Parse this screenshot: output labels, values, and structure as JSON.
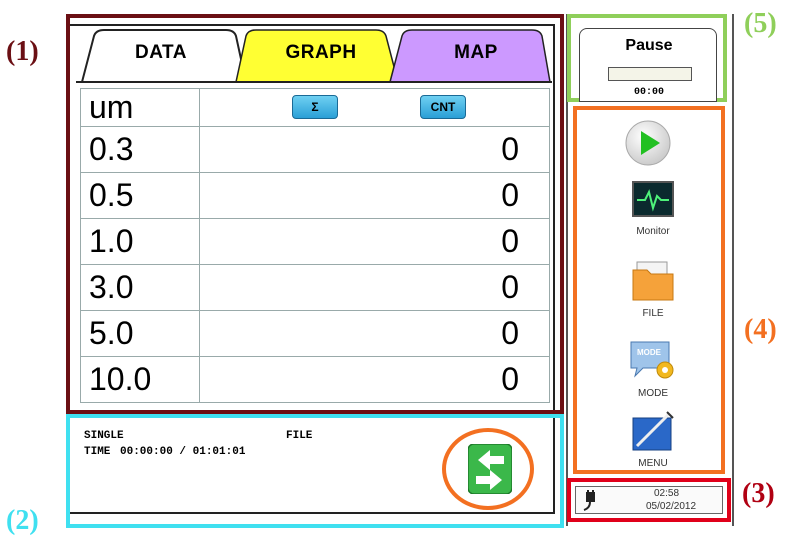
{
  "callouts": {
    "c1": "(1)",
    "c2": "(2)",
    "c3": "(3)",
    "c4": "(4)",
    "c5": "(5)"
  },
  "tabs": [
    {
      "label": "DATA",
      "color": "#ffffff"
    },
    {
      "label": "GRAPH",
      "color": "#ffff33"
    },
    {
      "label": "MAP",
      "color": "#cc99ff"
    }
  ],
  "table": {
    "header_unit": "um",
    "header_buttons": [
      "Σ",
      "CNT"
    ],
    "rows": [
      {
        "size": "0.3",
        "value": "0"
      },
      {
        "size": "0.5",
        "value": "0"
      },
      {
        "size": "1.0",
        "value": "0"
      },
      {
        "size": "3.0",
        "value": "0"
      },
      {
        "size": "5.0",
        "value": "0"
      },
      {
        "size": "10.0",
        "value": "0"
      }
    ]
  },
  "status": {
    "mode": "SINGLE",
    "file": "FILE",
    "time_label": "TIME",
    "time_value": "00:00:00 / 01:01:01"
  },
  "pause_panel": {
    "label": "Pause",
    "timer": "00:00"
  },
  "side_menu": [
    {
      "icon": "play-icon",
      "label": ""
    },
    {
      "icon": "monitor-icon",
      "label": "Monitor"
    },
    {
      "icon": "folder-icon",
      "label": "FILE"
    },
    {
      "icon": "mode-icon",
      "label": "MODE"
    },
    {
      "icon": "menu-icon",
      "label": "MENU"
    }
  ],
  "clock": {
    "time": "02:58",
    "date": "05/02/2012"
  },
  "colors": {
    "frame1": "#6b0f14",
    "frame2": "#3fe0f0",
    "frame3": "#e0001a",
    "frame4": "#f37021",
    "frame5": "#8fcf5a",
    "callout1": "#6b0f14",
    "callout2": "#3fe0f0",
    "callout3": "#b00012",
    "callout4": "#f37021",
    "callout5": "#8fcf5a"
  }
}
